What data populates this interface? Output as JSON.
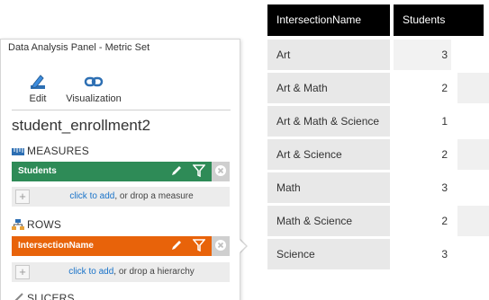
{
  "table": {
    "headers": [
      "IntersectionName",
      "Students"
    ],
    "rows": [
      {
        "name": "Art",
        "count": "3"
      },
      {
        "name": "Art & Math",
        "count": "2"
      },
      {
        "name": "Art & Math & Science",
        "count": "1"
      },
      {
        "name": "Art & Science",
        "count": "2"
      },
      {
        "name": "Math",
        "count": "3"
      },
      {
        "name": "Math & Science",
        "count": "2"
      },
      {
        "name": "Science",
        "count": "3"
      }
    ]
  },
  "panel": {
    "title": "Data Analysis Panel - Metric Set",
    "tools": {
      "edit": "Edit",
      "visualization": "Visualization"
    },
    "model_name": "student_enrollment2",
    "measures": {
      "section_label": "MEASURES",
      "item": "Students",
      "drop_link": "click to add",
      "drop_rest": ", or drop a measure"
    },
    "rows": {
      "section_label": "ROWS",
      "item": "IntersectionName",
      "drop_link": "click to add",
      "drop_rest": ", or drop a hierarchy"
    },
    "slicers": {
      "section_label": "SLICERS"
    }
  },
  "colors": {
    "measure_pill": "#2e8b57",
    "row_pill": "#e8630a",
    "link": "#1a73c9",
    "table_header": "#000000"
  },
  "icons": [
    "pencil-icon",
    "chain-link-icon",
    "ruler-icon",
    "hierarchy-icon",
    "filter-icon",
    "remove-icon",
    "plus-icon"
  ]
}
